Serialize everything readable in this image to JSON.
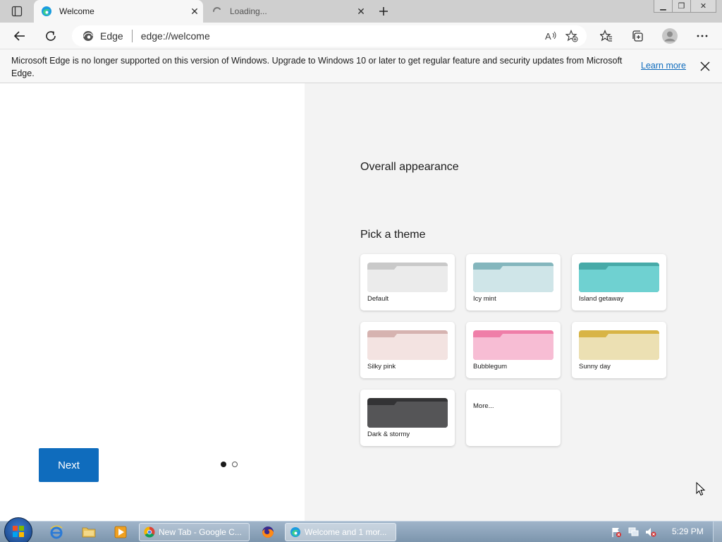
{
  "window": {
    "tabs": [
      {
        "title": "Welcome",
        "state": "active",
        "icon": "edge-icon"
      },
      {
        "title": "Loading...",
        "state": "inactive",
        "icon": "spinner-icon"
      }
    ],
    "new_tab_label": "+"
  },
  "toolbar": {
    "site_label": "Edge",
    "url": "edge://welcome"
  },
  "infobar": {
    "message": "Microsoft Edge is no longer supported on this version of Windows. Upgrade to Windows 10 or later to get regular feature and security updates from Microsoft Edge.",
    "learn_more": "Learn more"
  },
  "content": {
    "overall_appearance": "Overall appearance",
    "pick_theme": "Pick a theme",
    "themes": [
      {
        "label": "Default",
        "top_color": "#c9c9c9",
        "body_color": "#ebebeb"
      },
      {
        "label": "Icy mint",
        "top_color": "#84b6bd",
        "body_color": "#cfe5e8"
      },
      {
        "label": "Island getaway",
        "top_color": "#47aaa8",
        "body_color": "#6fd1d1"
      },
      {
        "label": "Silky pink",
        "top_color": "#d6b3b0",
        "body_color": "#f3e3e1"
      },
      {
        "label": "Bubblegum",
        "top_color": "#ef7ea8",
        "body_color": "#f7bdd4"
      },
      {
        "label": "Sunny day",
        "top_color": "#d8b446",
        "body_color": "#ece0b3"
      },
      {
        "label": "Dark & stormy",
        "top_color": "#333335",
        "body_color": "#555557"
      }
    ],
    "more_label": "More...",
    "next_button": "Next",
    "pager": {
      "current": 1,
      "total": 2
    }
  },
  "taskbar": {
    "tasks": [
      {
        "label": "New Tab - Google C...",
        "icon": "chrome-icon"
      },
      {
        "label": "Welcome and 1 mor...",
        "icon": "edge-icon",
        "active": true
      }
    ],
    "clock": "5:29 PM"
  }
}
